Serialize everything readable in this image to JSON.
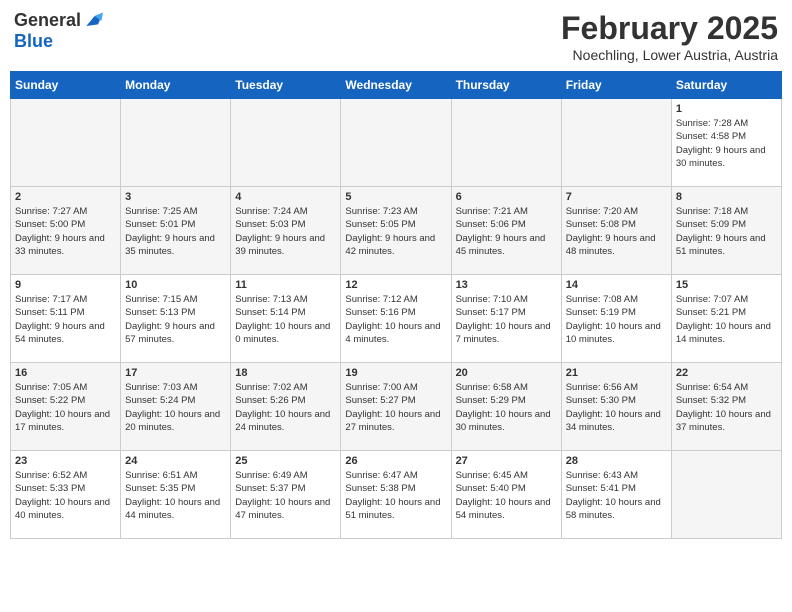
{
  "header": {
    "logo_general": "General",
    "logo_blue": "Blue",
    "month_title": "February 2025",
    "location": "Noechling, Lower Austria, Austria"
  },
  "weekdays": [
    "Sunday",
    "Monday",
    "Tuesday",
    "Wednesday",
    "Thursday",
    "Friday",
    "Saturday"
  ],
  "weeks": [
    [
      {
        "day": "",
        "info": ""
      },
      {
        "day": "",
        "info": ""
      },
      {
        "day": "",
        "info": ""
      },
      {
        "day": "",
        "info": ""
      },
      {
        "day": "",
        "info": ""
      },
      {
        "day": "",
        "info": ""
      },
      {
        "day": "1",
        "info": "Sunrise: 7:28 AM\nSunset: 4:58 PM\nDaylight: 9 hours and 30 minutes."
      }
    ],
    [
      {
        "day": "2",
        "info": "Sunrise: 7:27 AM\nSunset: 5:00 PM\nDaylight: 9 hours and 33 minutes."
      },
      {
        "day": "3",
        "info": "Sunrise: 7:25 AM\nSunset: 5:01 PM\nDaylight: 9 hours and 35 minutes."
      },
      {
        "day": "4",
        "info": "Sunrise: 7:24 AM\nSunset: 5:03 PM\nDaylight: 9 hours and 39 minutes."
      },
      {
        "day": "5",
        "info": "Sunrise: 7:23 AM\nSunset: 5:05 PM\nDaylight: 9 hours and 42 minutes."
      },
      {
        "day": "6",
        "info": "Sunrise: 7:21 AM\nSunset: 5:06 PM\nDaylight: 9 hours and 45 minutes."
      },
      {
        "day": "7",
        "info": "Sunrise: 7:20 AM\nSunset: 5:08 PM\nDaylight: 9 hours and 48 minutes."
      },
      {
        "day": "8",
        "info": "Sunrise: 7:18 AM\nSunset: 5:09 PM\nDaylight: 9 hours and 51 minutes."
      }
    ],
    [
      {
        "day": "9",
        "info": "Sunrise: 7:17 AM\nSunset: 5:11 PM\nDaylight: 9 hours and 54 minutes."
      },
      {
        "day": "10",
        "info": "Sunrise: 7:15 AM\nSunset: 5:13 PM\nDaylight: 9 hours and 57 minutes."
      },
      {
        "day": "11",
        "info": "Sunrise: 7:13 AM\nSunset: 5:14 PM\nDaylight: 10 hours and 0 minutes."
      },
      {
        "day": "12",
        "info": "Sunrise: 7:12 AM\nSunset: 5:16 PM\nDaylight: 10 hours and 4 minutes."
      },
      {
        "day": "13",
        "info": "Sunrise: 7:10 AM\nSunset: 5:17 PM\nDaylight: 10 hours and 7 minutes."
      },
      {
        "day": "14",
        "info": "Sunrise: 7:08 AM\nSunset: 5:19 PM\nDaylight: 10 hours and 10 minutes."
      },
      {
        "day": "15",
        "info": "Sunrise: 7:07 AM\nSunset: 5:21 PM\nDaylight: 10 hours and 14 minutes."
      }
    ],
    [
      {
        "day": "16",
        "info": "Sunrise: 7:05 AM\nSunset: 5:22 PM\nDaylight: 10 hours and 17 minutes."
      },
      {
        "day": "17",
        "info": "Sunrise: 7:03 AM\nSunset: 5:24 PM\nDaylight: 10 hours and 20 minutes."
      },
      {
        "day": "18",
        "info": "Sunrise: 7:02 AM\nSunset: 5:26 PM\nDaylight: 10 hours and 24 minutes."
      },
      {
        "day": "19",
        "info": "Sunrise: 7:00 AM\nSunset: 5:27 PM\nDaylight: 10 hours and 27 minutes."
      },
      {
        "day": "20",
        "info": "Sunrise: 6:58 AM\nSunset: 5:29 PM\nDaylight: 10 hours and 30 minutes."
      },
      {
        "day": "21",
        "info": "Sunrise: 6:56 AM\nSunset: 5:30 PM\nDaylight: 10 hours and 34 minutes."
      },
      {
        "day": "22",
        "info": "Sunrise: 6:54 AM\nSunset: 5:32 PM\nDaylight: 10 hours and 37 minutes."
      }
    ],
    [
      {
        "day": "23",
        "info": "Sunrise: 6:52 AM\nSunset: 5:33 PM\nDaylight: 10 hours and 40 minutes."
      },
      {
        "day": "24",
        "info": "Sunrise: 6:51 AM\nSunset: 5:35 PM\nDaylight: 10 hours and 44 minutes."
      },
      {
        "day": "25",
        "info": "Sunrise: 6:49 AM\nSunset: 5:37 PM\nDaylight: 10 hours and 47 minutes."
      },
      {
        "day": "26",
        "info": "Sunrise: 6:47 AM\nSunset: 5:38 PM\nDaylight: 10 hours and 51 minutes."
      },
      {
        "day": "27",
        "info": "Sunrise: 6:45 AM\nSunset: 5:40 PM\nDaylight: 10 hours and 54 minutes."
      },
      {
        "day": "28",
        "info": "Sunrise: 6:43 AM\nSunset: 5:41 PM\nDaylight: 10 hours and 58 minutes."
      },
      {
        "day": "",
        "info": ""
      }
    ]
  ]
}
